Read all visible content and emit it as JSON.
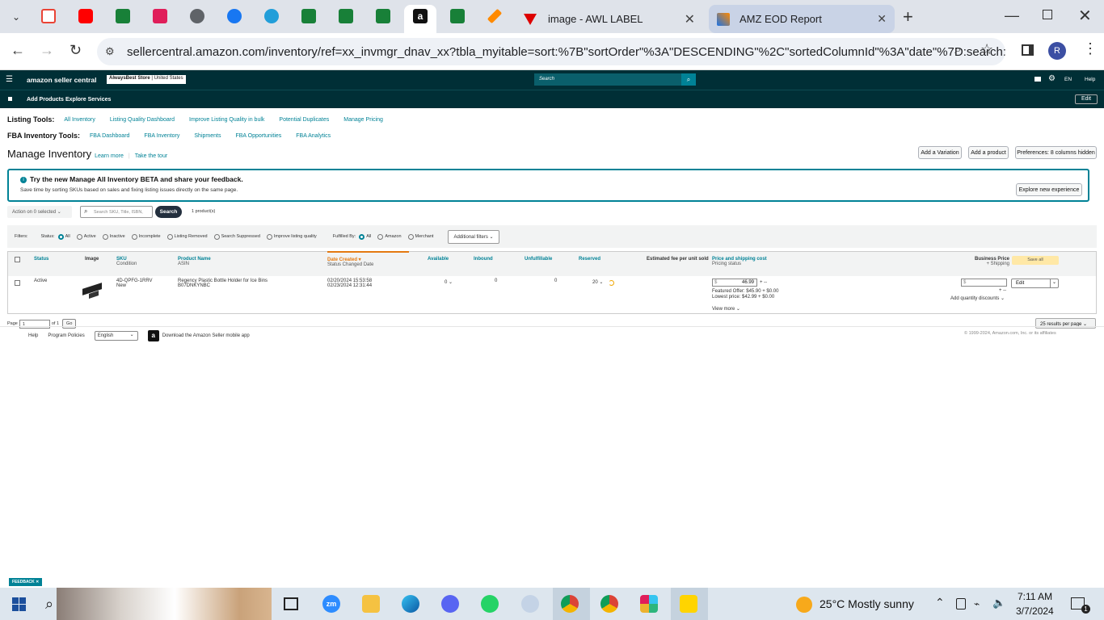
{
  "browser": {
    "tabs": [
      {
        "title": "image - AWL LABEL"
      },
      {
        "title": "AMZ EOD Report"
      }
    ],
    "url": "sellercentral.amazon.com/inventory/ref=xx_invmgr_dnav_xx?tbla_myitable=sort:%7B\"sortOrder\"%3A\"DESCENDING\"%2C\"sortedColumnId\"%3A\"date\"%7D:search::p...",
    "profile_letter": "R"
  },
  "amazon": {
    "logo": "amazon seller central",
    "store": "AlwaysBest Store",
    "marketplace": "United States",
    "search_placeholder": "Search",
    "lang": "EN",
    "help": "Help",
    "nav": [
      "Add Products",
      "Explore Services"
    ],
    "edit": "Edit"
  },
  "listing_tools": {
    "label": "Listing Tools:",
    "links": [
      "All Inventory",
      "Listing Quality Dashboard",
      "Improve Listing Quality in bulk",
      "Potential Duplicates",
      "Manage Pricing"
    ]
  },
  "fba_tools": {
    "label": "FBA Inventory Tools:",
    "links": [
      "FBA Dashboard",
      "FBA Inventory",
      "Shipments",
      "FBA Opportunities",
      "FBA Analytics"
    ]
  },
  "page": {
    "title": "Manage Inventory",
    "learn_more": "Learn more",
    "tour": "Take the tour",
    "buttons": [
      "Add a Variation",
      "Add a product",
      "Preferences: 8 columns hidden"
    ]
  },
  "banner": {
    "title": "Try the new Manage All Inventory BETA and share your feedback.",
    "text": "Save time by sorting SKUs based on sales and fixing listing issues directly on the same page.",
    "button": "Explore new experience"
  },
  "actions": {
    "action_select": "Action on 0 selected",
    "search_placeholder": "Search SKU, Title, ISBN,",
    "search_button": "Search",
    "count": "1 product(s)"
  },
  "filters": {
    "label": "Filters:",
    "status_label": "Status:",
    "status": [
      "All",
      "Active",
      "Inactive",
      "Incomplete",
      "Listing Removed",
      "Search Suppressed",
      "Improve listing quality"
    ],
    "fulfilled_label": "Fulfilled By:",
    "fulfilled": [
      "All",
      "Amazon",
      "Merchant"
    ],
    "additional": "Additional filters"
  },
  "table": {
    "headers": {
      "status": "Status",
      "image": "Image",
      "sku": "SKU",
      "sku_sub": "Condition",
      "name": "Product Name",
      "name_sub": "ASIN",
      "date": "Date Created",
      "date_sub": "Status Changed Date",
      "available": "Available",
      "inbound": "Inbound",
      "unfulfillable": "Unfulfillable",
      "reserved": "Reserved",
      "fee": "Estimated fee per unit sold",
      "price": "Price and shipping cost",
      "price_sub": "Pricing status",
      "business": "Business Price",
      "business_sub": "+ Shipping",
      "save_all": "Save all"
    },
    "row": {
      "status": "Active",
      "sku": "4D-QPFG-1RRV",
      "condition": "New",
      "name": "Regency Plastic Bottle Holder for Ice Bins",
      "asin": "B07DNKYNBC",
      "date_created": "02/20/2024 15:53:58",
      "date_changed": "02/23/2024 12:31:44",
      "available": "0",
      "inbound": "0",
      "unfulfillable": "0",
      "reserved": "20",
      "price_prefix": "$",
      "price": "46.99",
      "shipping": "+ --",
      "featured": "Featured Offer: $45.90 + $0.00",
      "lowest": "Lowest price: $42.99 + $0.00",
      "view_more": "View more",
      "business_prefix": "$",
      "business_ship": "+ --",
      "quantity_discounts": "Add quantity discounts",
      "edit": "Edit"
    }
  },
  "pager": {
    "page_label": "Page",
    "page": "1",
    "of": "of 1",
    "go": "Go",
    "per_page": "25 results per page"
  },
  "footer": {
    "links": [
      "Help",
      "Program Policies"
    ],
    "language": "English",
    "app": "Download the Amazon Seller mobile app",
    "copyright": "© 1999-2024, Amazon.com, Inc. or its affiliates"
  },
  "feedback": "FEEDBACK",
  "taskbar": {
    "weather": "25°C  Mostly sunny",
    "time": "7:11 AM",
    "date": "3/7/2024",
    "notif": "1"
  }
}
